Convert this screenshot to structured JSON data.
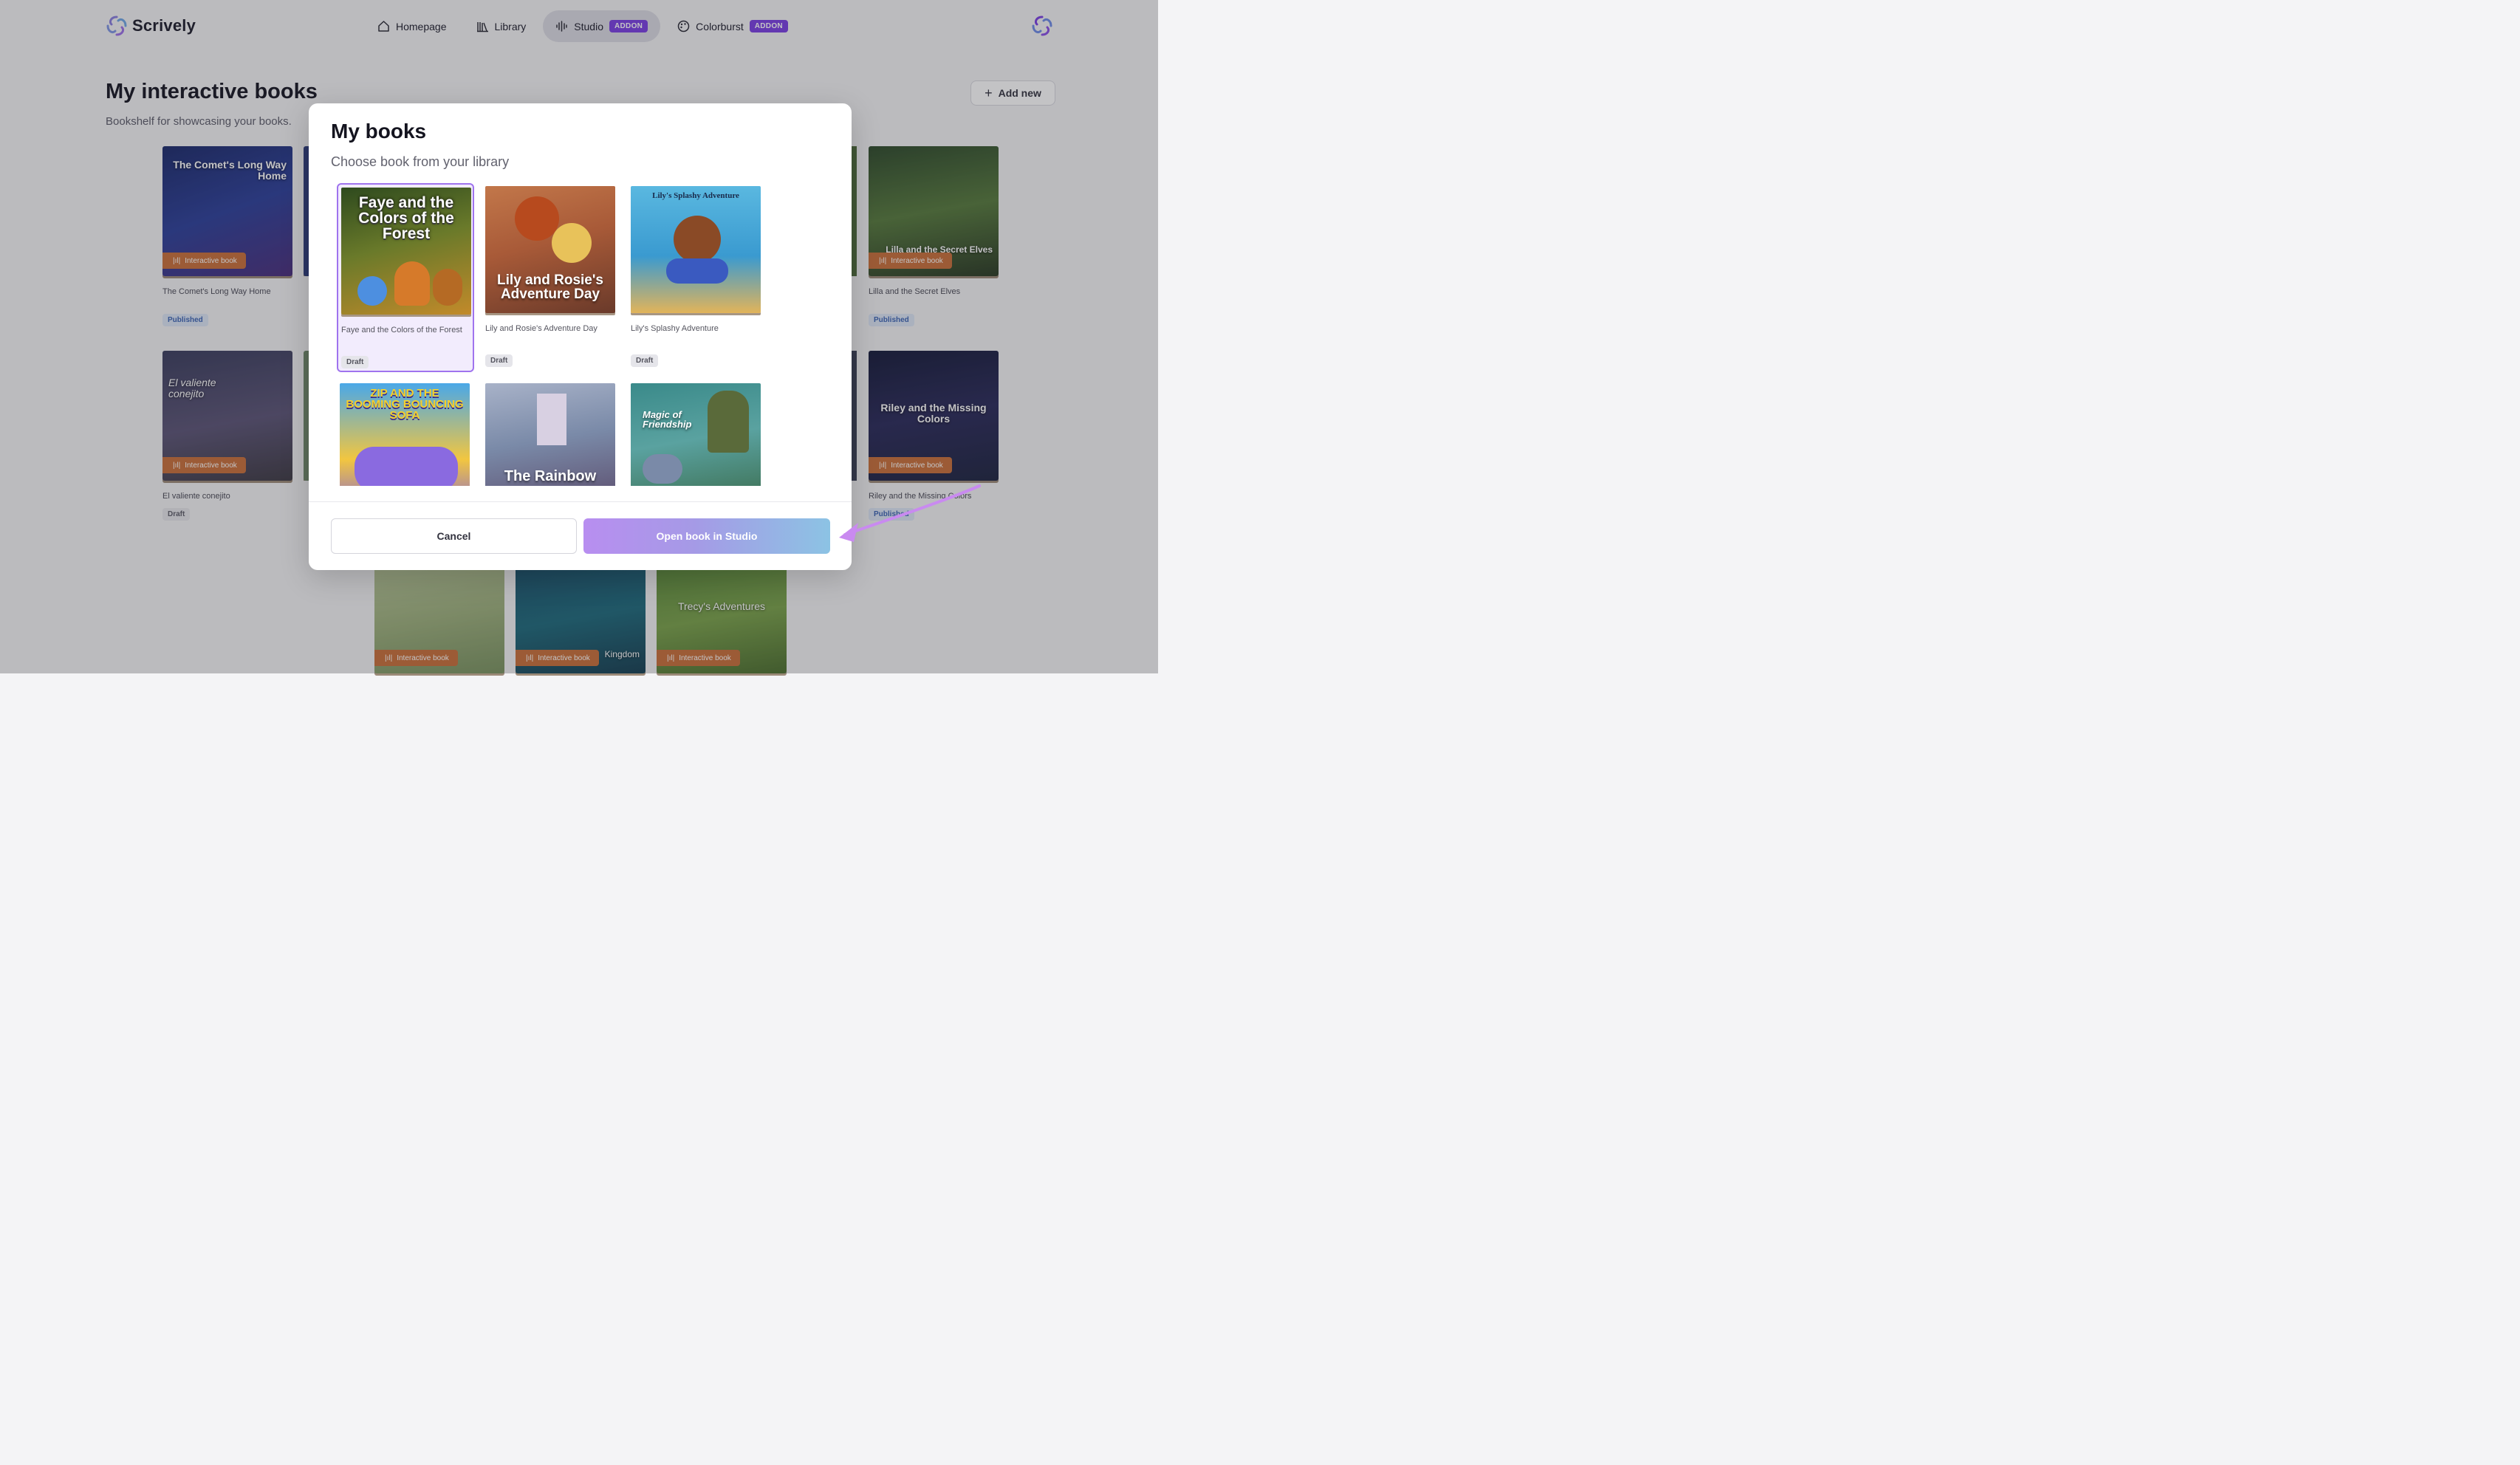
{
  "brand": {
    "name": "Scrively"
  },
  "nav": {
    "items": [
      {
        "label": "Homepage",
        "icon": "home-icon",
        "active": false
      },
      {
        "label": "Library",
        "icon": "library-icon",
        "active": false
      },
      {
        "label": "Studio",
        "icon": "audio-waveform-icon",
        "active": true,
        "badge": "ADDON"
      },
      {
        "label": "Colorburst",
        "icon": "palette-icon",
        "active": false,
        "badge": "ADDON"
      }
    ]
  },
  "page": {
    "title": "My interactive books",
    "subtitle": "Bookshelf for showcasing your books.",
    "add_new_label": "Add new"
  },
  "background_books": [
    {
      "title": "The Comet's Long Way Home",
      "cover_text": "The Comet's Long Way Home",
      "badge": "Interactive book",
      "status": "Published"
    },
    {
      "title": "Lilla and the Secret Elves",
      "cover_text": "Lilla and the Secret Elves",
      "badge": "Interactive book",
      "status": "Published"
    },
    {
      "title": "El valiente conejito",
      "cover_text": "El valiente conejito",
      "badge": "Interactive book",
      "status": "Draft"
    },
    {
      "title": "Riley and the Missing Colors",
      "cover_text": "Riley and the Missing Colors",
      "badge": "Interactive book",
      "status": "Published"
    },
    {
      "badge": "Interactive book"
    },
    {
      "badge": "Interactive book",
      "cover_text": "Kingdom"
    },
    {
      "badge": "Interactive book",
      "cover_text": "Trecy's Adventures"
    }
  ],
  "modal": {
    "title": "My books",
    "subtitle": "Choose book from your library",
    "books": [
      {
        "title": "Faye and the Colors of the Forest",
        "cover_text": "Faye and the Colors of the Forest",
        "status": "Draft",
        "selected": true
      },
      {
        "title": "Lily and Rosie's Adventure Day",
        "cover_text": "Lily and Rosie's Adventure Day",
        "status": "Draft",
        "selected": false
      },
      {
        "title": "Lily's Splashy Adventure",
        "cover_text": "Lily's Splashy Adventure",
        "status": "Draft",
        "selected": false
      },
      {
        "cover_text": "ZIP AND THE BOOMING BOUNCING SOFA"
      },
      {
        "cover_text": "The Rainbow"
      },
      {
        "cover_text": "Magic of Friendship"
      }
    ],
    "cancel_label": "Cancel",
    "open_label": "Open book in Studio"
  },
  "colors": {
    "accent": "#7b3fe4",
    "badge_orange": "#c9703a",
    "arrow": "#c98af0"
  }
}
